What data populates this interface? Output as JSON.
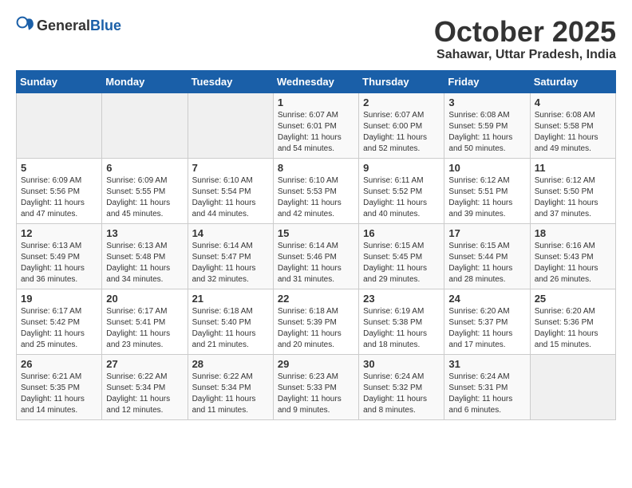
{
  "header": {
    "logo_general": "General",
    "logo_blue": "Blue",
    "month": "October 2025",
    "location": "Sahawar, Uttar Pradesh, India"
  },
  "weekdays": [
    "Sunday",
    "Monday",
    "Tuesday",
    "Wednesday",
    "Thursday",
    "Friday",
    "Saturday"
  ],
  "weeks": [
    [
      {
        "day": "",
        "info": ""
      },
      {
        "day": "",
        "info": ""
      },
      {
        "day": "",
        "info": ""
      },
      {
        "day": "1",
        "info": "Sunrise: 6:07 AM\nSunset: 6:01 PM\nDaylight: 11 hours\nand 54 minutes."
      },
      {
        "day": "2",
        "info": "Sunrise: 6:07 AM\nSunset: 6:00 PM\nDaylight: 11 hours\nand 52 minutes."
      },
      {
        "day": "3",
        "info": "Sunrise: 6:08 AM\nSunset: 5:59 PM\nDaylight: 11 hours\nand 50 minutes."
      },
      {
        "day": "4",
        "info": "Sunrise: 6:08 AM\nSunset: 5:58 PM\nDaylight: 11 hours\nand 49 minutes."
      }
    ],
    [
      {
        "day": "5",
        "info": "Sunrise: 6:09 AM\nSunset: 5:56 PM\nDaylight: 11 hours\nand 47 minutes."
      },
      {
        "day": "6",
        "info": "Sunrise: 6:09 AM\nSunset: 5:55 PM\nDaylight: 11 hours\nand 45 minutes."
      },
      {
        "day": "7",
        "info": "Sunrise: 6:10 AM\nSunset: 5:54 PM\nDaylight: 11 hours\nand 44 minutes."
      },
      {
        "day": "8",
        "info": "Sunrise: 6:10 AM\nSunset: 5:53 PM\nDaylight: 11 hours\nand 42 minutes."
      },
      {
        "day": "9",
        "info": "Sunrise: 6:11 AM\nSunset: 5:52 PM\nDaylight: 11 hours\nand 40 minutes."
      },
      {
        "day": "10",
        "info": "Sunrise: 6:12 AM\nSunset: 5:51 PM\nDaylight: 11 hours\nand 39 minutes."
      },
      {
        "day": "11",
        "info": "Sunrise: 6:12 AM\nSunset: 5:50 PM\nDaylight: 11 hours\nand 37 minutes."
      }
    ],
    [
      {
        "day": "12",
        "info": "Sunrise: 6:13 AM\nSunset: 5:49 PM\nDaylight: 11 hours\nand 36 minutes."
      },
      {
        "day": "13",
        "info": "Sunrise: 6:13 AM\nSunset: 5:48 PM\nDaylight: 11 hours\nand 34 minutes."
      },
      {
        "day": "14",
        "info": "Sunrise: 6:14 AM\nSunset: 5:47 PM\nDaylight: 11 hours\nand 32 minutes."
      },
      {
        "day": "15",
        "info": "Sunrise: 6:14 AM\nSunset: 5:46 PM\nDaylight: 11 hours\nand 31 minutes."
      },
      {
        "day": "16",
        "info": "Sunrise: 6:15 AM\nSunset: 5:45 PM\nDaylight: 11 hours\nand 29 minutes."
      },
      {
        "day": "17",
        "info": "Sunrise: 6:15 AM\nSunset: 5:44 PM\nDaylight: 11 hours\nand 28 minutes."
      },
      {
        "day": "18",
        "info": "Sunrise: 6:16 AM\nSunset: 5:43 PM\nDaylight: 11 hours\nand 26 minutes."
      }
    ],
    [
      {
        "day": "19",
        "info": "Sunrise: 6:17 AM\nSunset: 5:42 PM\nDaylight: 11 hours\nand 25 minutes."
      },
      {
        "day": "20",
        "info": "Sunrise: 6:17 AM\nSunset: 5:41 PM\nDaylight: 11 hours\nand 23 minutes."
      },
      {
        "day": "21",
        "info": "Sunrise: 6:18 AM\nSunset: 5:40 PM\nDaylight: 11 hours\nand 21 minutes."
      },
      {
        "day": "22",
        "info": "Sunrise: 6:18 AM\nSunset: 5:39 PM\nDaylight: 11 hours\nand 20 minutes."
      },
      {
        "day": "23",
        "info": "Sunrise: 6:19 AM\nSunset: 5:38 PM\nDaylight: 11 hours\nand 18 minutes."
      },
      {
        "day": "24",
        "info": "Sunrise: 6:20 AM\nSunset: 5:37 PM\nDaylight: 11 hours\nand 17 minutes."
      },
      {
        "day": "25",
        "info": "Sunrise: 6:20 AM\nSunset: 5:36 PM\nDaylight: 11 hours\nand 15 minutes."
      }
    ],
    [
      {
        "day": "26",
        "info": "Sunrise: 6:21 AM\nSunset: 5:35 PM\nDaylight: 11 hours\nand 14 minutes."
      },
      {
        "day": "27",
        "info": "Sunrise: 6:22 AM\nSunset: 5:34 PM\nDaylight: 11 hours\nand 12 minutes."
      },
      {
        "day": "28",
        "info": "Sunrise: 6:22 AM\nSunset: 5:34 PM\nDaylight: 11 hours\nand 11 minutes."
      },
      {
        "day": "29",
        "info": "Sunrise: 6:23 AM\nSunset: 5:33 PM\nDaylight: 11 hours\nand 9 minutes."
      },
      {
        "day": "30",
        "info": "Sunrise: 6:24 AM\nSunset: 5:32 PM\nDaylight: 11 hours\nand 8 minutes."
      },
      {
        "day": "31",
        "info": "Sunrise: 6:24 AM\nSunset: 5:31 PM\nDaylight: 11 hours\nand 6 minutes."
      },
      {
        "day": "",
        "info": ""
      }
    ]
  ]
}
